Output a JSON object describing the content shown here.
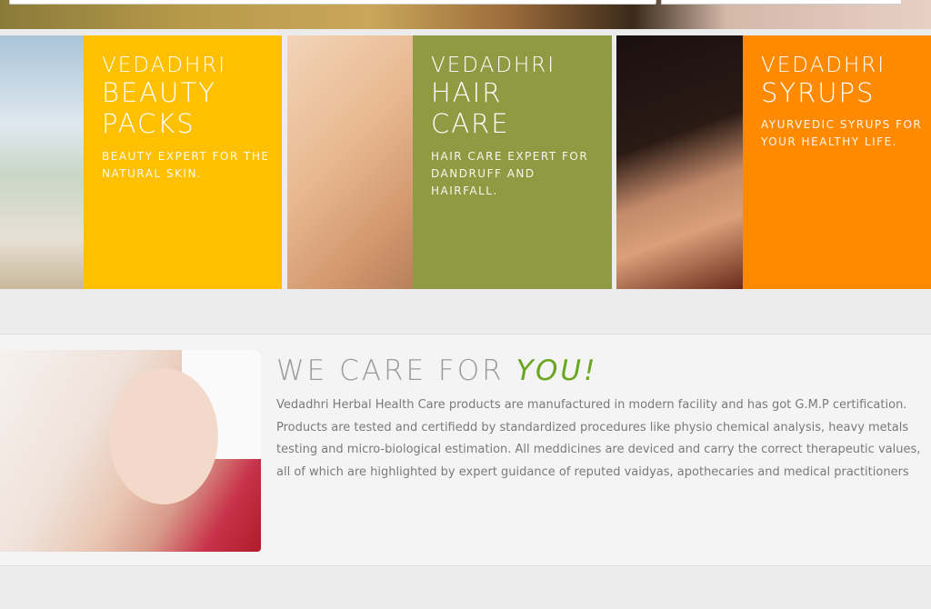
{
  "tiles": [
    {
      "line1": "VEDADHRI",
      "line2a": "BEAUTY",
      "line2b": "PACKS",
      "desc": [
        "BEAUTY EXPERT FOR THE",
        "NATURAL SKIN."
      ]
    },
    {
      "line1": "VEDADHRI",
      "line2a": "HAIR",
      "line2b": "CARE",
      "desc": [
        "HAIR CARE EXPERT FOR",
        "DANDRUFF AND",
        "HAIRFALL."
      ]
    },
    {
      "line1": "VEDADHRI",
      "line2a": "SYRUPS",
      "line2b": "",
      "desc": [
        "AYURVEDIC SYRUPS FOR",
        "YOUR HEALTHY LIFE."
      ]
    }
  ],
  "care": {
    "title_plain": "WE CARE FOR ",
    "title_accent": "YOU!",
    "lines": [
      "Vedadhri Herbal Health Care products are manufactured in modern facility and has got G.M.P certification.",
      "Products are tested and certifiedd by standardized procedures like physio chemical analysis, heavy metals",
      "testing and micro-biological estimation. All meddicines are deviced and carry the correct therapeutic values,",
      "all of which are highlighted by expert guidance of reputed vaidyas, apothecaries and medical practitioners"
    ]
  },
  "colors": {
    "beauty": "#ffc000",
    "hair": "#8f9a43",
    "syrups": "#ff8a00",
    "accent": "#6aa620"
  }
}
